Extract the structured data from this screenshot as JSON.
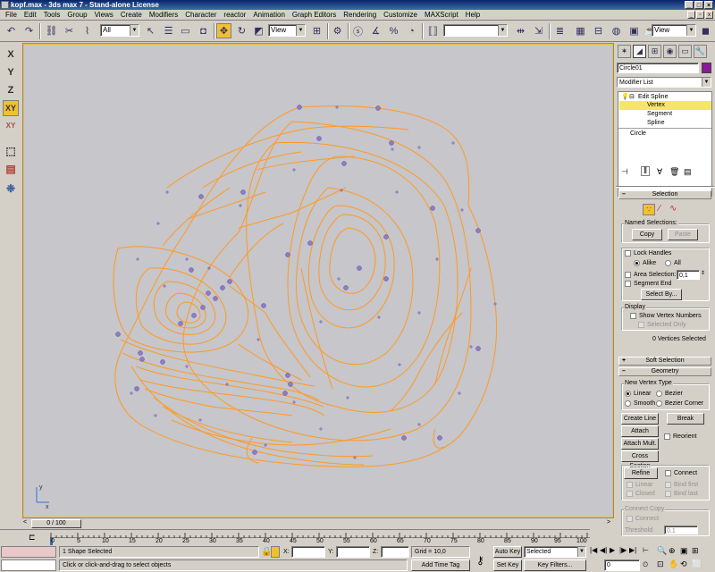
{
  "window": {
    "title": "kopf.max - 3ds max 7 - Stand-alone License",
    "controls": [
      "_",
      "□",
      "×"
    ]
  },
  "menu": [
    "File",
    "Edit",
    "Tools",
    "Group",
    "Views",
    "Create",
    "Modifiers",
    "Character",
    "reactor",
    "Animation",
    "Graph Editors",
    "Rendering",
    "Customize",
    "MAXScript",
    "Help"
  ],
  "toolbar": {
    "selection_filter": "All",
    "ref_coord": "View",
    "named_selection": "",
    "viewport_select": "View"
  },
  "left_tools": [
    "X",
    "Y",
    "Z",
    "XY",
    "XY"
  ],
  "command_panel": {
    "object_name": "Circle01",
    "object_color": "#8a1a9a",
    "modifier_list": "Modifier List",
    "stack": {
      "edit_spline": "Edit Spline",
      "vertex": "Vertex",
      "segment": "Segment",
      "spline": "Spline",
      "circle": "Circle"
    },
    "selection": {
      "title": "Selection",
      "named_selections": "Named Selections:",
      "copy": "Copy",
      "paste": "Paste",
      "lock_handles": "Lock Handles",
      "alike": "Alike",
      "all": "All",
      "area_selection": "Area Selection:",
      "area_value": "0,1",
      "segment_end": "Segment End",
      "select_by": "Select By...",
      "display": "Display",
      "show_vertex_numbers": "Show Vertex Numbers",
      "selected_only": "Selected Only",
      "vertices_selected": "0 Vertices Selected"
    },
    "soft_selection": {
      "title": "Soft Selection"
    },
    "geometry": {
      "title": "Geometry",
      "new_vertex_type": "New Vertex Type",
      "linear": "Linear",
      "bezier": "Bezier",
      "smooth": "Smooth",
      "bezier_corner": "Bezier Corner",
      "create_line": "Create Line",
      "break": "Break",
      "attach": "Attach",
      "reorient": "Reorient",
      "attach_mult": "Attach Mult.",
      "cross_section": "Cross Section",
      "refine": "Refine",
      "connect": "Connect",
      "linear2": "Linear",
      "bind_first": "Bind first",
      "closed": "Closed",
      "bind_last": "Bind last",
      "connect_copy": "Connect Copy",
      "connect2": "Connect",
      "threshold": "Threshold",
      "threshold_value": "0,1"
    }
  },
  "timeline": {
    "frame_label": "0 / 100",
    "ticks": [
      "0",
      "5",
      "10",
      "15",
      "20",
      "25",
      "30",
      "35",
      "40",
      "45",
      "50",
      "55",
      "60",
      "65",
      "70",
      "75",
      "80",
      "85",
      "90",
      "95",
      "100"
    ]
  },
  "status": {
    "selection": "1 Shape Selected",
    "prompt": "Click or click-and-drag to select objects",
    "x_label": "X:",
    "y_label": "Y:",
    "z_label": "Z:",
    "x_value": "",
    "y_value": "",
    "z_value": "",
    "grid": "Grid = 10,0",
    "add_time_tag": "Add Time Tag",
    "auto_key": "Auto Key",
    "set_key": "Set Key",
    "key_mode": "Selected",
    "key_filters": "Key Filters...",
    "current_frame": "0"
  },
  "colors": {
    "spline": "#ff9a22",
    "vertex": "#8e7cc8",
    "active_tool": "#f0c030",
    "viewport_bg": "#c6c6cb"
  }
}
